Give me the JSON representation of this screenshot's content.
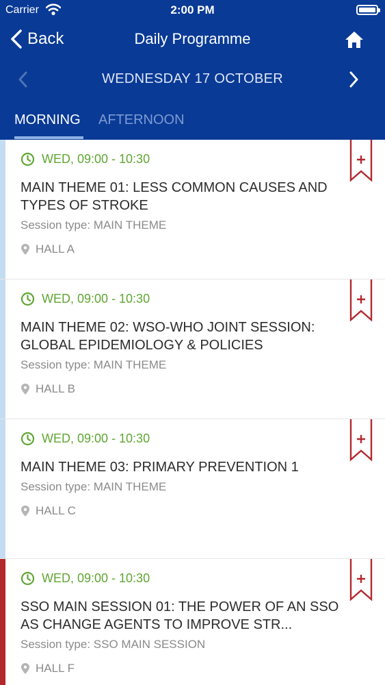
{
  "status_bar": {
    "carrier": "Carrier",
    "time": "2:00 PM"
  },
  "nav": {
    "back_label": "Back",
    "title": "Daily Programme"
  },
  "date_bar": {
    "label": "WEDNESDAY 17 OCTOBER"
  },
  "tabs": [
    {
      "label": "MORNING",
      "active": true
    },
    {
      "label": "AFTERNOON",
      "active": false
    }
  ],
  "colors": {
    "header": "#093a96",
    "time_green": "#5fa632",
    "bookmark_red": "#b3282d",
    "strip_blue": "#c3dcf2",
    "strip_red": "#b3282d"
  },
  "sessions": [
    {
      "time": "WED, 09:00 - 10:30",
      "title": "MAIN THEME 01: LESS COMMON CAUSES AND TYPES OF STROKE",
      "type": "Session type: MAIN THEME",
      "hall": "HALL A",
      "strip": "blue"
    },
    {
      "time": "WED, 09:00 - 10:30",
      "title": "MAIN THEME 02: WSO-WHO JOINT SESSION: GLOBAL EPIDEMIOLOGY & POLICIES",
      "type": "Session type: MAIN THEME",
      "hall": "HALL B",
      "strip": "blue"
    },
    {
      "time": "WED, 09:00 - 10:30",
      "title": "MAIN THEME 03: PRIMARY PREVENTION 1",
      "type": "Session type: MAIN THEME",
      "hall": "HALL C",
      "strip": "blue"
    },
    {
      "time": "WED, 09:00 - 10:30",
      "title": "SSO MAIN SESSION 01: THE POWER OF AN SSO AS CHANGE AGENTS TO IMPROVE STR...",
      "type": "Session type: SSO MAIN SESSION",
      "hall": "HALL F",
      "strip": "red"
    }
  ]
}
